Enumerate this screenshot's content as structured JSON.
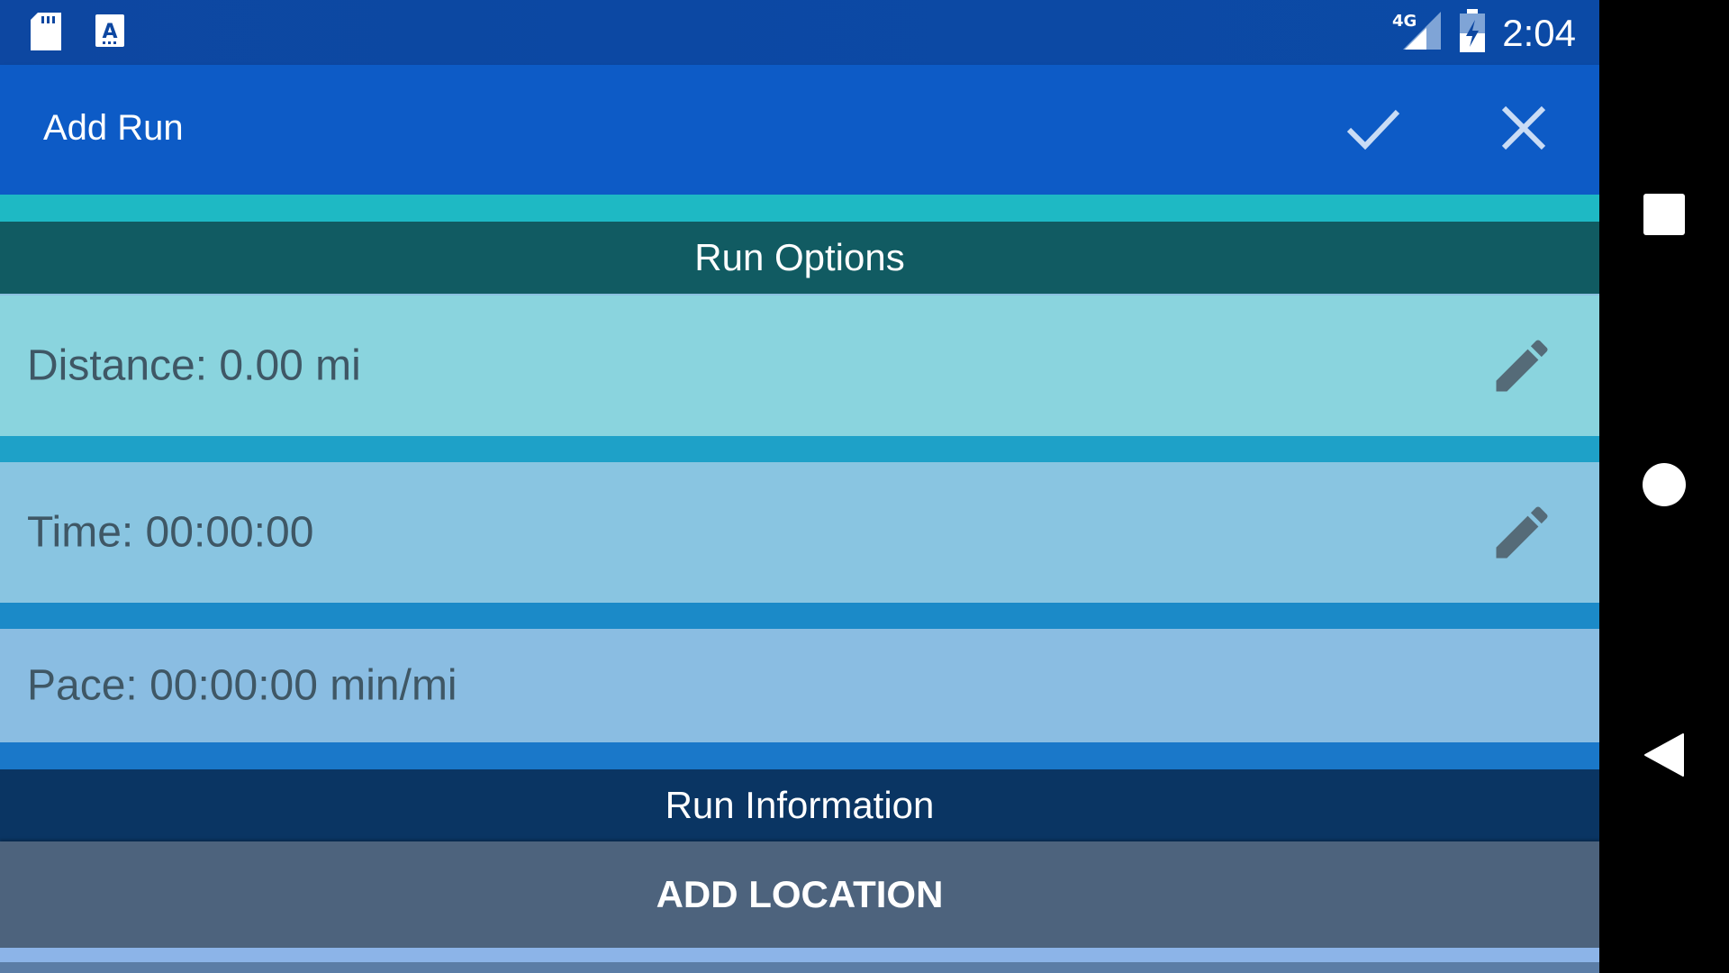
{
  "status_bar": {
    "time": "2:04",
    "network": "4G",
    "icons": [
      "sd-card-icon",
      "keyboard-a-icon",
      "signal-4g-icon",
      "battery-charging-icon"
    ]
  },
  "app_bar": {
    "title": "Add Run",
    "confirm_icon": "check-icon",
    "close_icon": "close-icon"
  },
  "sections": {
    "run_options": "Run Options",
    "run_information": "Run Information"
  },
  "rows": {
    "distance": "Distance: 0.00 mi",
    "time": "Time: 00:00:00",
    "pace": "Pace: 00:00:00 min/mi"
  },
  "add_location_label": "ADD LOCATION",
  "nav": {
    "recent_icon": "square-recent-apps-icon",
    "home_icon": "circle-home-icon",
    "back_icon": "triangle-back-icon"
  },
  "colors": {
    "status_bar": "#0d47a1",
    "app_bar": "#0d5bc6",
    "run_options_header": "#115b62",
    "run_information_header": "#0a3563",
    "add_location_button": "#4d637d"
  }
}
